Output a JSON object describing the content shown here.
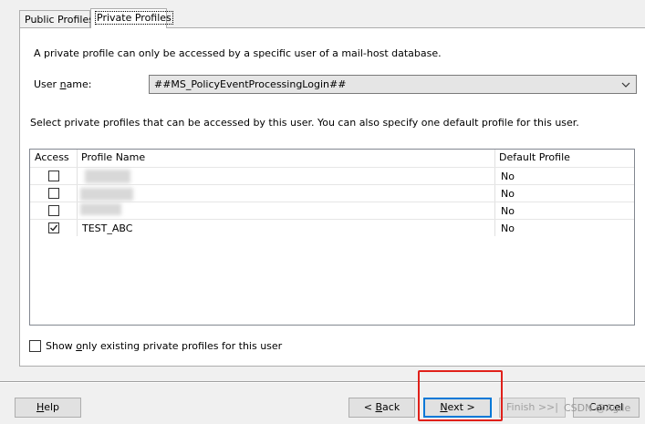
{
  "tabs": [
    {
      "label": "Public Profiles",
      "active": false
    },
    {
      "label": "Private Profiles",
      "active": true
    }
  ],
  "description": "A private profile can only be accessed by a specific user of a mail-host database.",
  "user_name": {
    "label_pre": "User ",
    "label_accel": "n",
    "label_post": "ame:",
    "value": "##MS_PolicyEventProcessingLogin##"
  },
  "instruction": "Select private profiles that can be accessed by this user. You can also specify one default profile for this user.",
  "grid": {
    "columns": [
      "Access",
      "Profile Name",
      "Default Profile"
    ],
    "rows": [
      {
        "access": false,
        "profile": "",
        "default": "No",
        "redacted": true
      },
      {
        "access": false,
        "profile": "",
        "default": "No",
        "redacted": true
      },
      {
        "access": false,
        "profile": "",
        "default": "No",
        "redacted": true
      },
      {
        "access": true,
        "profile": "TEST_ABC",
        "default": "No",
        "redacted": false
      }
    ]
  },
  "show_existing": {
    "checked": false,
    "label_pre": "Show ",
    "label_accel": "o",
    "label_post": "nly existing private profiles for this user"
  },
  "buttons": {
    "help": {
      "accel": "H",
      "rest": "elp"
    },
    "back": {
      "pre": "< ",
      "accel": "B",
      "rest": "ack"
    },
    "next": {
      "accel": "N",
      "rest": "ext >"
    },
    "finish": "Finish >>|",
    "cancel": "Cancel"
  },
  "watermark": "CSDN @Agile"
}
